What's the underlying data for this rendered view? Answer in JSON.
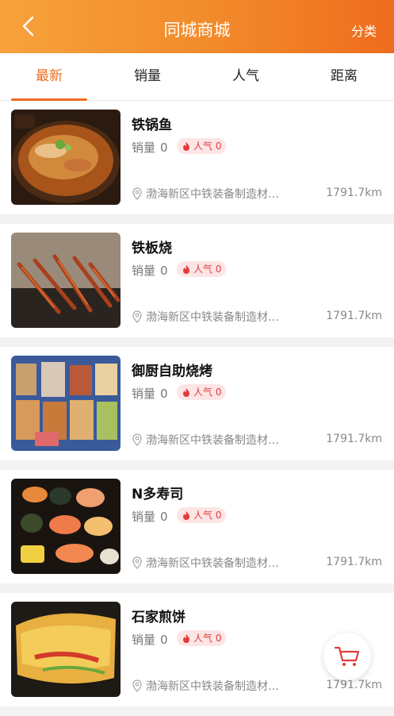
{
  "header": {
    "title": "同城商城",
    "category": "分类"
  },
  "tabs": [
    {
      "label": "最新",
      "active": true
    },
    {
      "label": "销量",
      "active": false
    },
    {
      "label": "人气",
      "active": false
    },
    {
      "label": "距离",
      "active": false
    }
  ],
  "items": [
    {
      "name": "铁锅鱼",
      "sales_label": "销量",
      "sales": "0",
      "popularity": "人气 0",
      "address": "渤海新区中铁装备制造材…",
      "distance": "1791.7km"
    },
    {
      "name": "铁板烧",
      "sales_label": "销量",
      "sales": "0",
      "popularity": "人气 0",
      "address": "渤海新区中铁装备制造材…",
      "distance": "1791.7km"
    },
    {
      "name": "御厨自助烧烤",
      "sales_label": "销量",
      "sales": "0",
      "popularity": "人气 0",
      "address": "渤海新区中铁装备制造材…",
      "distance": "1791.7km"
    },
    {
      "name": "N多寿司",
      "sales_label": "销量",
      "sales": "0",
      "popularity": "人气 0",
      "address": "渤海新区中铁装备制造材…",
      "distance": "1791.7km"
    },
    {
      "name": "石家煎饼",
      "sales_label": "销量",
      "sales": "0",
      "popularity": "人气 0",
      "address": "渤海新区中铁装备制造材…",
      "distance": "1791.7km"
    }
  ],
  "icons": {
    "back": "chevron-left-icon",
    "popularity": "flame-icon",
    "location": "location-pin-icon",
    "cart": "shopping-cart-icon"
  },
  "colors": {
    "accent": "#ef6c1e",
    "header_start": "#f7a23c",
    "popularity_bg": "#fde5e5",
    "popularity_text": "#e23b3b"
  }
}
